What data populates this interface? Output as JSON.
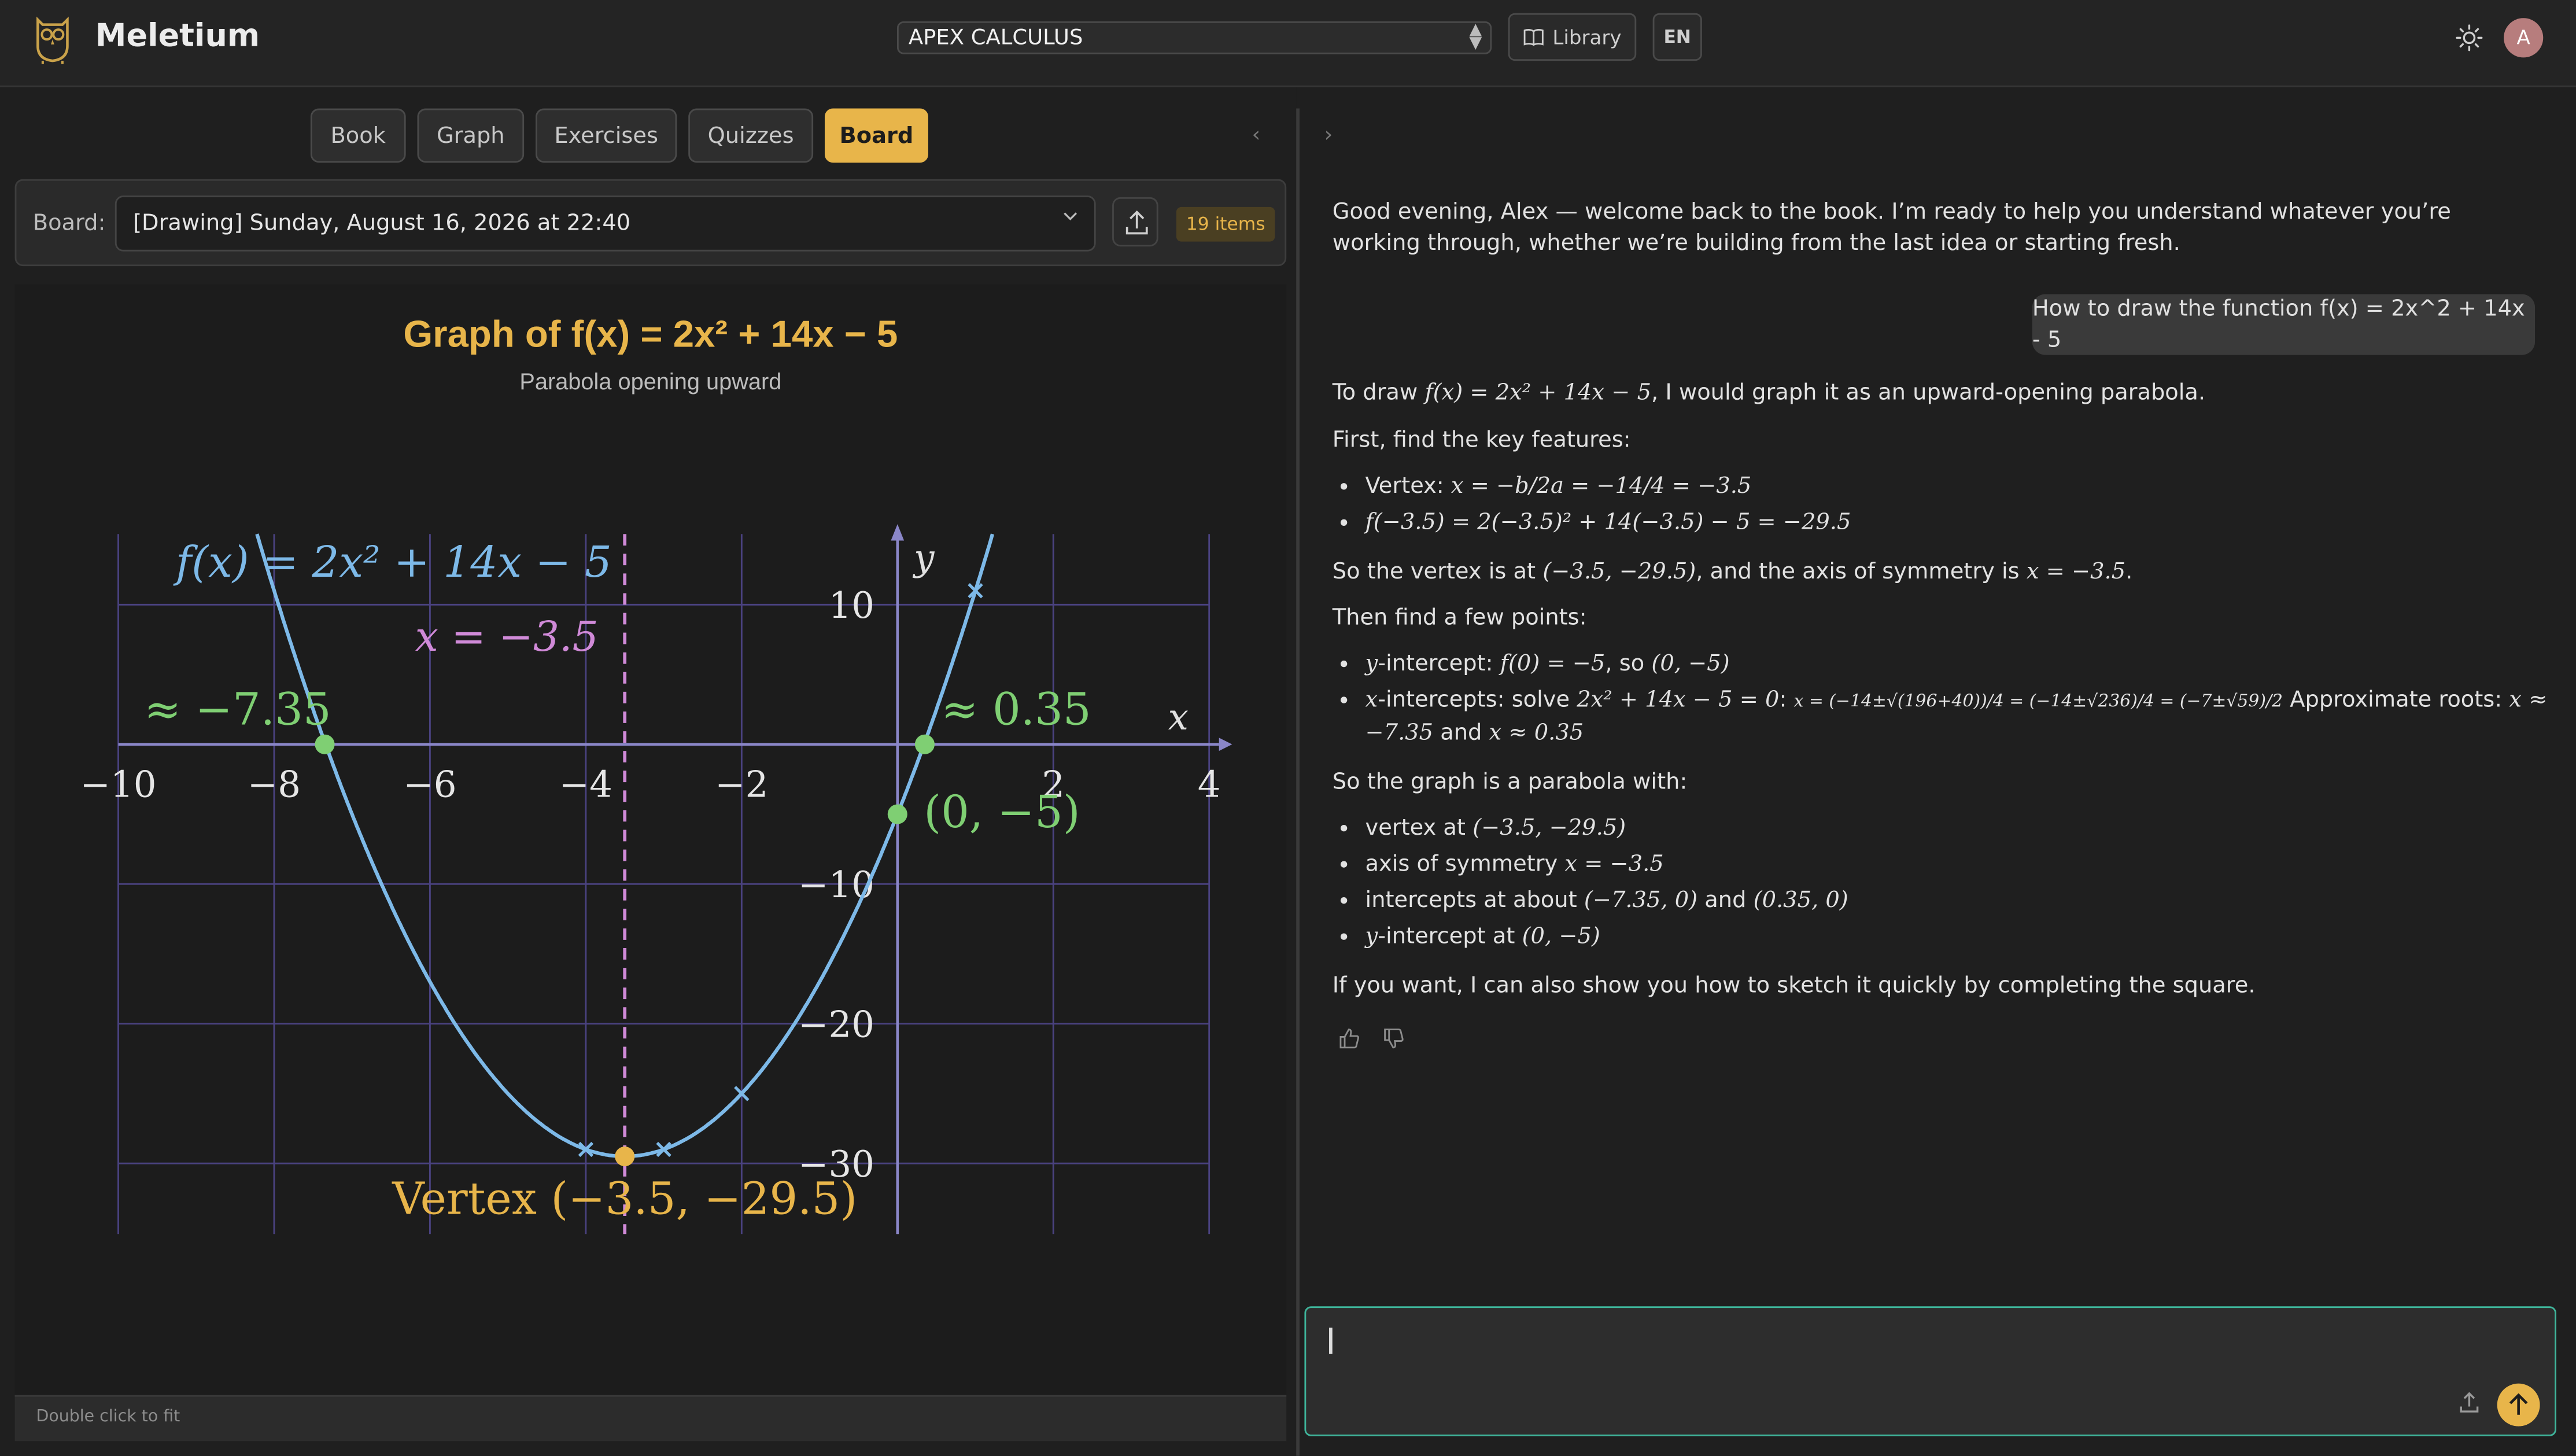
{
  "app": {
    "title": "Meletium",
    "logo_icon": "owl-icon"
  },
  "topbar": {
    "book_select": "APEX CALCULUS",
    "library_label": "Library",
    "lang_label": "EN",
    "avatar_initial": "A"
  },
  "tabs": [
    {
      "label": "Book",
      "active": false
    },
    {
      "label": "Graph",
      "active": false
    },
    {
      "label": "Exercises",
      "active": false
    },
    {
      "label": "Quizzes",
      "active": false
    },
    {
      "label": "Board",
      "active": true
    }
  ],
  "board": {
    "label": "Board:",
    "selected": "[Drawing] Sunday, August 16, 2026 at 22:40",
    "items_badge": "19 items",
    "footer_hint": "Double click to fit"
  },
  "chart_data": {
    "type": "line",
    "title": "Graph of f(x) = 2x² + 14x − 5",
    "subtitle": "Parabola opening upward",
    "function": "f(x) = 2x² + 14x − 5",
    "xlabel": "x",
    "ylabel": "y",
    "xlim": [
      -10,
      4
    ],
    "ylim": [
      -35,
      15
    ],
    "x_ticks": [
      -10,
      -8,
      -6,
      -4,
      -2,
      2,
      4
    ],
    "y_ticks": [
      10,
      -10,
      -20,
      -30
    ],
    "x_tick_labels": [
      "−10",
      "−8",
      "−6",
      "−4",
      "−2",
      "2",
      "4"
    ],
    "y_tick_labels": [
      "10",
      "−10",
      "−20",
      "−30"
    ],
    "grid": true,
    "series": [
      {
        "name": "f(x) = 2x² + 14x − 5",
        "color": "#7db9e8",
        "coefficients": [
          2,
          14,
          -5
        ]
      }
    ],
    "axis_of_symmetry": {
      "x": -3.5,
      "label": "x = −3.5",
      "color": "#d08ad8"
    },
    "markers": [
      {
        "x": -7.35,
        "y": 0,
        "label": "≈ −7.35",
        "color": "#7fcf73"
      },
      {
        "x": 0.35,
        "y": 0,
        "label": "≈ 0.35",
        "color": "#7fcf73"
      },
      {
        "x": 0,
        "y": -5,
        "label": "(0, −5)",
        "color": "#7fcf73"
      },
      {
        "x": -3.5,
        "y": -29.5,
        "label": "Vertex (−3.5, −29.5)",
        "color": "#e8b54a"
      }
    ],
    "cross_points": [
      {
        "x": 1,
        "y": 11
      },
      {
        "x": -2,
        "y": -25
      },
      {
        "x": -4,
        "y": -29
      },
      {
        "x": -3,
        "y": -29
      }
    ]
  },
  "chat": {
    "greeting": "Good evening, Alex — welcome back to the book. I’m ready to help you understand whatever you’re working through, whether we’re building from the last idea or starting fresh.",
    "user_message": "How to draw the function f(x) = 2x^2 + 14x - 5",
    "answer": {
      "intro_pre": "To draw ",
      "intro_math": "f(x) = 2x² + 14x − 5",
      "intro_post": ", I would graph it as an upward-opening parabola.",
      "key_features_heading": "First, find the key features:",
      "vertex_label": "Vertex: ",
      "vertex_math": "x = −b/2a = −14/4 = −3.5",
      "f_value_math": "f(−3.5) = 2(−3.5)² + 14(−3.5) − 5 = −29.5",
      "vertex_summary_pre": "So the vertex is at ",
      "vertex_summary_math1": "(−3.5, −29.5)",
      "vertex_summary_mid": ", and the axis of symmetry is ",
      "vertex_summary_math2": "x = −3.5",
      "vertex_summary_end": ".",
      "points_heading": "Then find a few points:",
      "y_intercept_label": "-intercept: ",
      "y_intercept_math": "f(0) = −5",
      "y_intercept_so": ", so ",
      "y_intercept_point": "(0, −5)",
      "x_intercepts_label": "-intercepts: solve ",
      "x_intercepts_eq": "2x² + 14x − 5 = 0",
      "x_intercepts_colon": ": ",
      "x_intercepts_formula": "x = (−14±√(196+40))/4 = (−14±√236)/4 = (−7±√59)/2",
      "approx_roots_label": " Approximate roots: ",
      "approx_root1": "x ≈ −7.35",
      "approx_and": " and ",
      "approx_root2": "x ≈ 0.35",
      "summary_heading": "So the graph is a parabola with:",
      "summary_vertex_label": "vertex at ",
      "summary_vertex_math": "(−3.5, −29.5)",
      "summary_axis_label": "axis of symmetry ",
      "summary_axis_math": "x = −3.5",
      "summary_intercepts_label": "intercepts at about ",
      "summary_intercepts_math1": "(−7.35, 0)",
      "summary_intercepts_and": " and ",
      "summary_intercepts_math2": "(0.35, 0)",
      "summary_yint_label": "-intercept at ",
      "summary_yint_math": "(0, −5)",
      "closing": "If you want, I can also show you how to sketch it quickly by completing the square.",
      "y_var": "y",
      "x_var": "x"
    },
    "composer_placeholder": ""
  },
  "colors": {
    "accent": "#e8b54a",
    "grid": "#4a4280",
    "curve": "#7db9e8",
    "composer_border": "#3fb59b"
  }
}
